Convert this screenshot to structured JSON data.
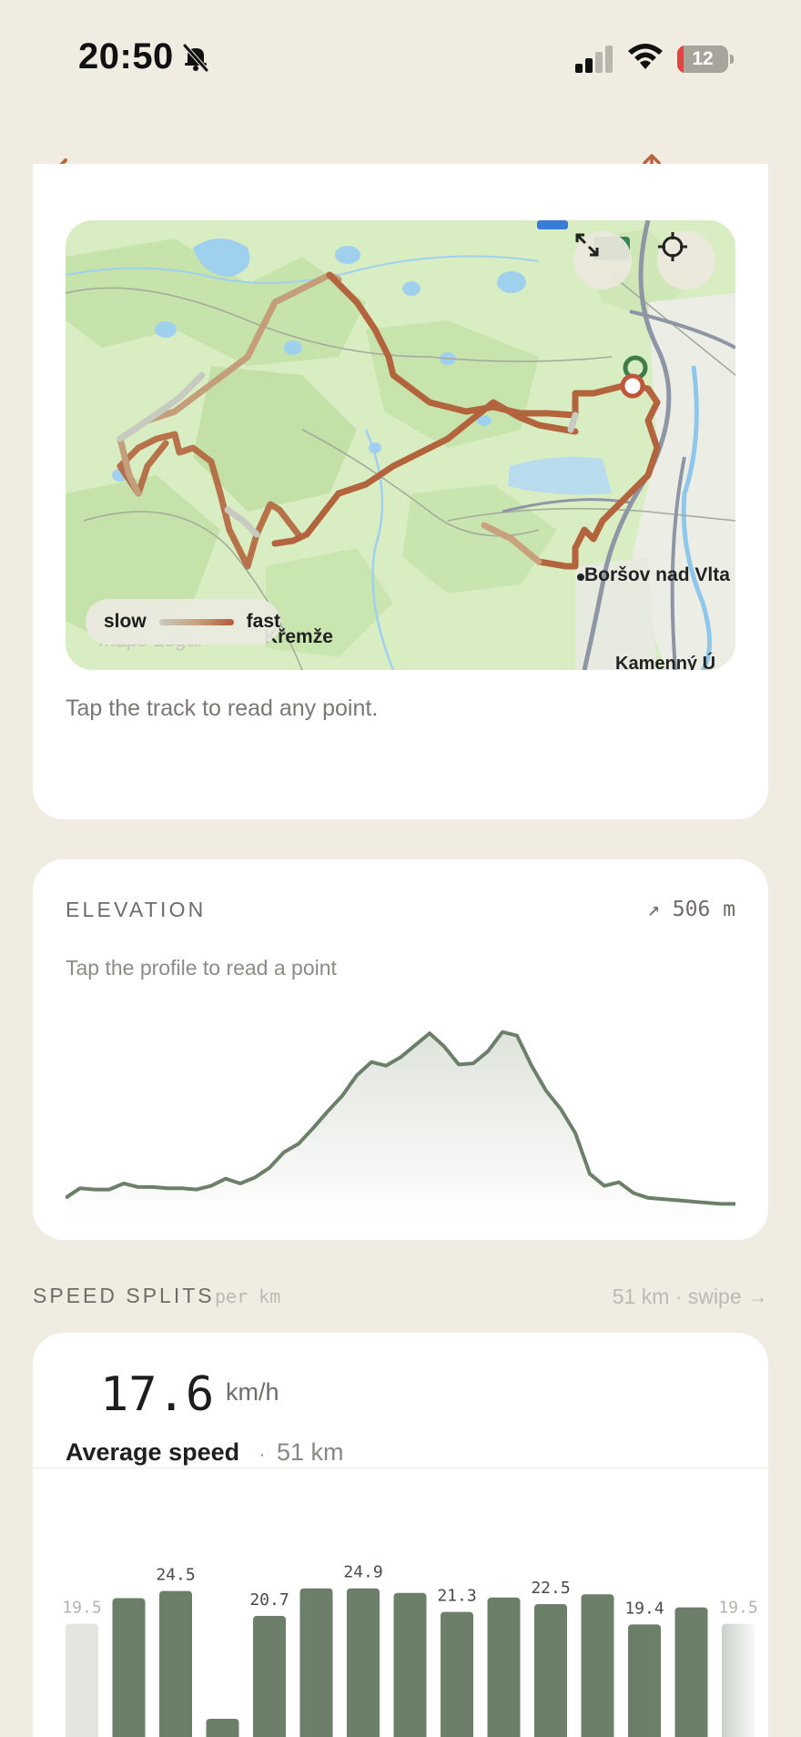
{
  "status_bar": {
    "time": "20:50",
    "battery_level": "12",
    "battery_fraction": 0.12
  },
  "nav": {
    "back_icon": "chevron-left-icon",
    "share_icon": "share-icon",
    "more_icon": "more-horizontal-icon"
  },
  "map": {
    "legend_slow": "slow",
    "legend_fast": "fast",
    "place_borsov": "Boršov nad Vlta",
    "place_kremze": "Křemže",
    "place_kamenny": "Kamenný Ú",
    "attribution": "Maps  Legal",
    "hint": "Tap the track to read any point.",
    "expand_icon": "expand-icon",
    "locate_icon": "crosshair-icon"
  },
  "elevation": {
    "title": "ELEVATION",
    "gain": "↗ 506 m",
    "hint": "Tap the profile to read a point",
    "profile": [
      10,
      18,
      17,
      17,
      22,
      19,
      19,
      18,
      18,
      17,
      20,
      26,
      22,
      27,
      35,
      48,
      55,
      68,
      82,
      95,
      112,
      123,
      120,
      127,
      137,
      147,
      136,
      121,
      122,
      132,
      148,
      145,
      120,
      99,
      84,
      64,
      30,
      20,
      23,
      14,
      10,
      9,
      8,
      7,
      6,
      5,
      5
    ]
  },
  "splits": {
    "title": "SPEED SPLITS",
    "unit": "per km",
    "summary": "51 km · swipe →",
    "average_value": "17.6",
    "average_unit": "km/h",
    "average_label": "Average speed",
    "average_separator": "·",
    "distance": "51 km",
    "colors": {
      "bar": "#6b7f69",
      "faded": "#e4e5de"
    },
    "chart_data": {
      "type": "bar",
      "values": [
        19.5,
        23.4,
        24.5,
        5.0,
        20.7,
        24.9,
        24.9,
        24.2,
        21.3,
        23.5,
        22.5,
        24.0,
        19.4,
        22.0,
        19.5
      ],
      "labels": [
        "19.5",
        "",
        "24.5",
        "",
        "20.7",
        "",
        "24.9",
        "",
        "21.3",
        "",
        "22.5",
        "",
        "19.4",
        "",
        "19.5"
      ]
    }
  }
}
